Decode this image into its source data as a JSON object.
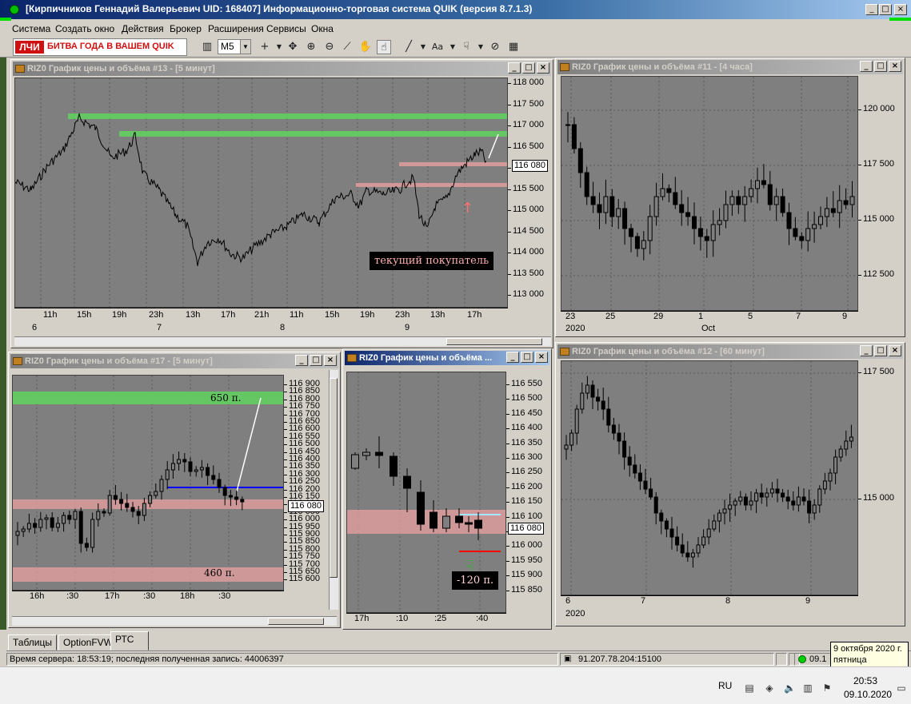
{
  "app": {
    "title": "[Кирпичников Геннадий Валерьевич UID: 168407] Информационно-торговая система QUIK (версия 8.7.1.3)",
    "window_buttons": [
      "_",
      "□",
      "×"
    ]
  },
  "menu": [
    "Система",
    "Создать окно",
    "Действия",
    "Брокер",
    "Расширения",
    "Сервисы",
    "Окна"
  ],
  "toolbar": {
    "promo_logo": "ЛЧИ",
    "promo_text": "БИТВА ГОДА В ВАШЕМ QUIK",
    "timeframe": "M5",
    "font_button": "Aa",
    "icons": [
      "chart-type-icon",
      "crosshair-icon",
      "move-icon",
      "zoom-in-icon",
      "zoom-out-icon",
      "ruler-icon",
      "hand-icon",
      "pointer-icon",
      "line-tool-icon",
      "text-tool-icon",
      "finger-icon",
      "hide-icon",
      "clear-icon"
    ]
  },
  "windows": {
    "w13": {
      "title": "RIZ0 График цены и объёма #13 - [5 минут]",
      "y_ticks": [
        "118 000",
        "117 500",
        "117 000",
        "116 500",
        "116 000",
        "115 500",
        "115 000",
        "114 500",
        "114 000",
        "113 500",
        "113 000"
      ],
      "x_hours": [
        "11h",
        "15h",
        "19h",
        "23h",
        "13h",
        "17h",
        "21h",
        "11h",
        "15h",
        "19h",
        "23h",
        "13h",
        "17h"
      ],
      "x_days": [
        "6",
        "7",
        "8",
        "9"
      ],
      "price_label": "116 080",
      "annotation": "текущий покупатель"
    },
    "w11": {
      "title": "RIZ0 График цены и объёма #11 - [4 часа]",
      "y_ticks": [
        "120 000",
        "117 500",
        "115 000",
        "112 500"
      ],
      "x_days": [
        "23",
        "25",
        "29",
        "1",
        "5",
        "7",
        "9"
      ],
      "x_bottom": [
        "2020",
        "Oct"
      ]
    },
    "w17": {
      "title": "RIZ0 График цены и объёма #17 - [5 минут]",
      "y_ticks": [
        "116 900",
        "116 850",
        "116 800",
        "116 750",
        "116 700",
        "116 650",
        "116 600",
        "116 550",
        "116 500",
        "116 450",
        "116 400",
        "116 350",
        "116 300",
        "116 250",
        "116 200",
        "116 150",
        "116 100",
        "116 050",
        "116 000",
        "115 950",
        "115 900",
        "115 850",
        "115 800",
        "115 750",
        "115 700",
        "115 650",
        "115 600"
      ],
      "x_ticks": [
        "16h",
        ":30",
        "17h",
        ":30",
        "18h",
        ":30"
      ],
      "price_label": "116 080",
      "upper_zone_label": "650 п.",
      "lower_zone_label": "460 п."
    },
    "w_small": {
      "title": "RIZ0 График цены и объёма ...",
      "y_ticks": [
        "116 550",
        "116 500",
        "116 450",
        "116 400",
        "116 350",
        "116 300",
        "116 250",
        "116 200",
        "116 150",
        "116 100",
        "116 050",
        "116 000",
        "115 950",
        "115 900",
        "115 850"
      ],
      "x_ticks": [
        "17h",
        ":10",
        ":25",
        ":40"
      ],
      "price_label": "116 080",
      "annotation": "-120 п."
    },
    "w12": {
      "title": "RIZ0 График цены и объёма #12 - [60 минут]",
      "y_ticks": [
        "117 500",
        "115 000"
      ],
      "x_days": [
        "6",
        "7",
        "8",
        "9"
      ],
      "x_bottom": [
        "2020"
      ]
    }
  },
  "tabs": [
    "Таблицы",
    "OptionFVW",
    "РТС"
  ],
  "status": {
    "server": "Время сервера: 18:53:19; последняя полученная запись: 44006397",
    "connection": "91.207.78.204:15100",
    "date_short": "09.1"
  },
  "tooltip": {
    "line1": "9 октября 2020 г.",
    "line2": "пятница"
  },
  "taskbar": {
    "lang": "RU",
    "time": "20:53",
    "date": "09.10.2020"
  },
  "colors": {
    "title_active": "#0a246a",
    "plot_bg": "#7f7f7f",
    "green_zone": "#5fd35f",
    "pink_zone": "#e8a0a0",
    "blue_line": "#0000ff",
    "red_line": "#ff0000",
    "cyan_line": "#a0e8ff"
  }
}
